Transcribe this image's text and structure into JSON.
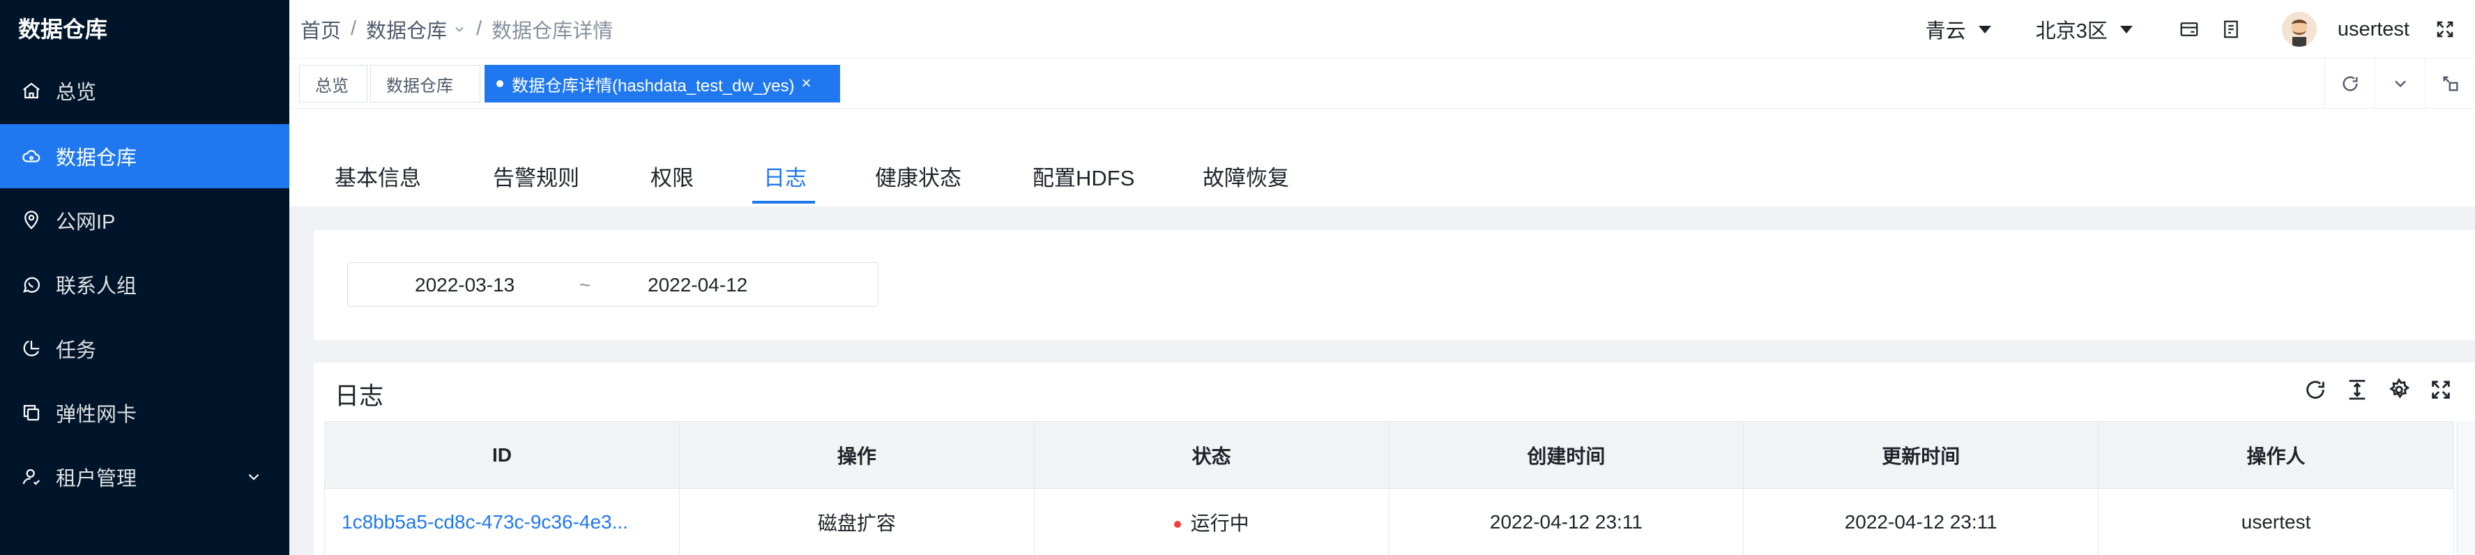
{
  "app": {
    "brand": "数据仓库"
  },
  "sidebar": {
    "items": [
      {
        "label": "总览",
        "icon": "home-icon"
      },
      {
        "label": "数据仓库",
        "icon": "cloud-icon",
        "active": true
      },
      {
        "label": "公网IP",
        "icon": "location-icon"
      },
      {
        "label": "联系人组",
        "icon": "chat-icon"
      },
      {
        "label": "任务",
        "icon": "pie-chart-icon"
      },
      {
        "label": "弹性网卡",
        "icon": "copy-icon"
      },
      {
        "label": "租户管理",
        "icon": "user-icon",
        "expandable": true
      }
    ]
  },
  "header": {
    "breadcrumb": [
      "首页",
      "数据仓库",
      "数据仓库详情"
    ],
    "breadcrumb_sep": "/",
    "cloud_select": "青云",
    "region_select": "北京3区",
    "username": "usertest"
  },
  "tabbar": {
    "tags": [
      {
        "label": "总览"
      },
      {
        "label": "数据仓库"
      },
      {
        "label": "数据仓库详情(hashdata_test_dw_yes)",
        "active": true,
        "close": "×"
      }
    ]
  },
  "content_tabs": [
    {
      "label": "基本信息"
    },
    {
      "label": "告警规则"
    },
    {
      "label": "权限"
    },
    {
      "label": "日志",
      "active": true
    },
    {
      "label": "健康状态"
    },
    {
      "label": "配置HDFS"
    },
    {
      "label": "故障恢复"
    }
  ],
  "filter": {
    "start_date": "2022-03-13",
    "range_sep": "~",
    "end_date": "2022-04-12"
  },
  "log": {
    "title": "日志",
    "columns": [
      "ID",
      "操作",
      "状态",
      "创建时间",
      "更新时间",
      "操作人"
    ],
    "rows": [
      {
        "id": "1c8bb5a5-cd8c-473c-9c36-4e3...",
        "operation": "磁盘扩容",
        "status": "运行中",
        "created": "2022-04-12 23:11",
        "updated": "2022-04-12 23:11",
        "operator": "usertest"
      }
    ]
  },
  "colors": {
    "sidebar_bg": "#001529",
    "accent": "#1f78f0",
    "status_running": "#f53f3f"
  }
}
